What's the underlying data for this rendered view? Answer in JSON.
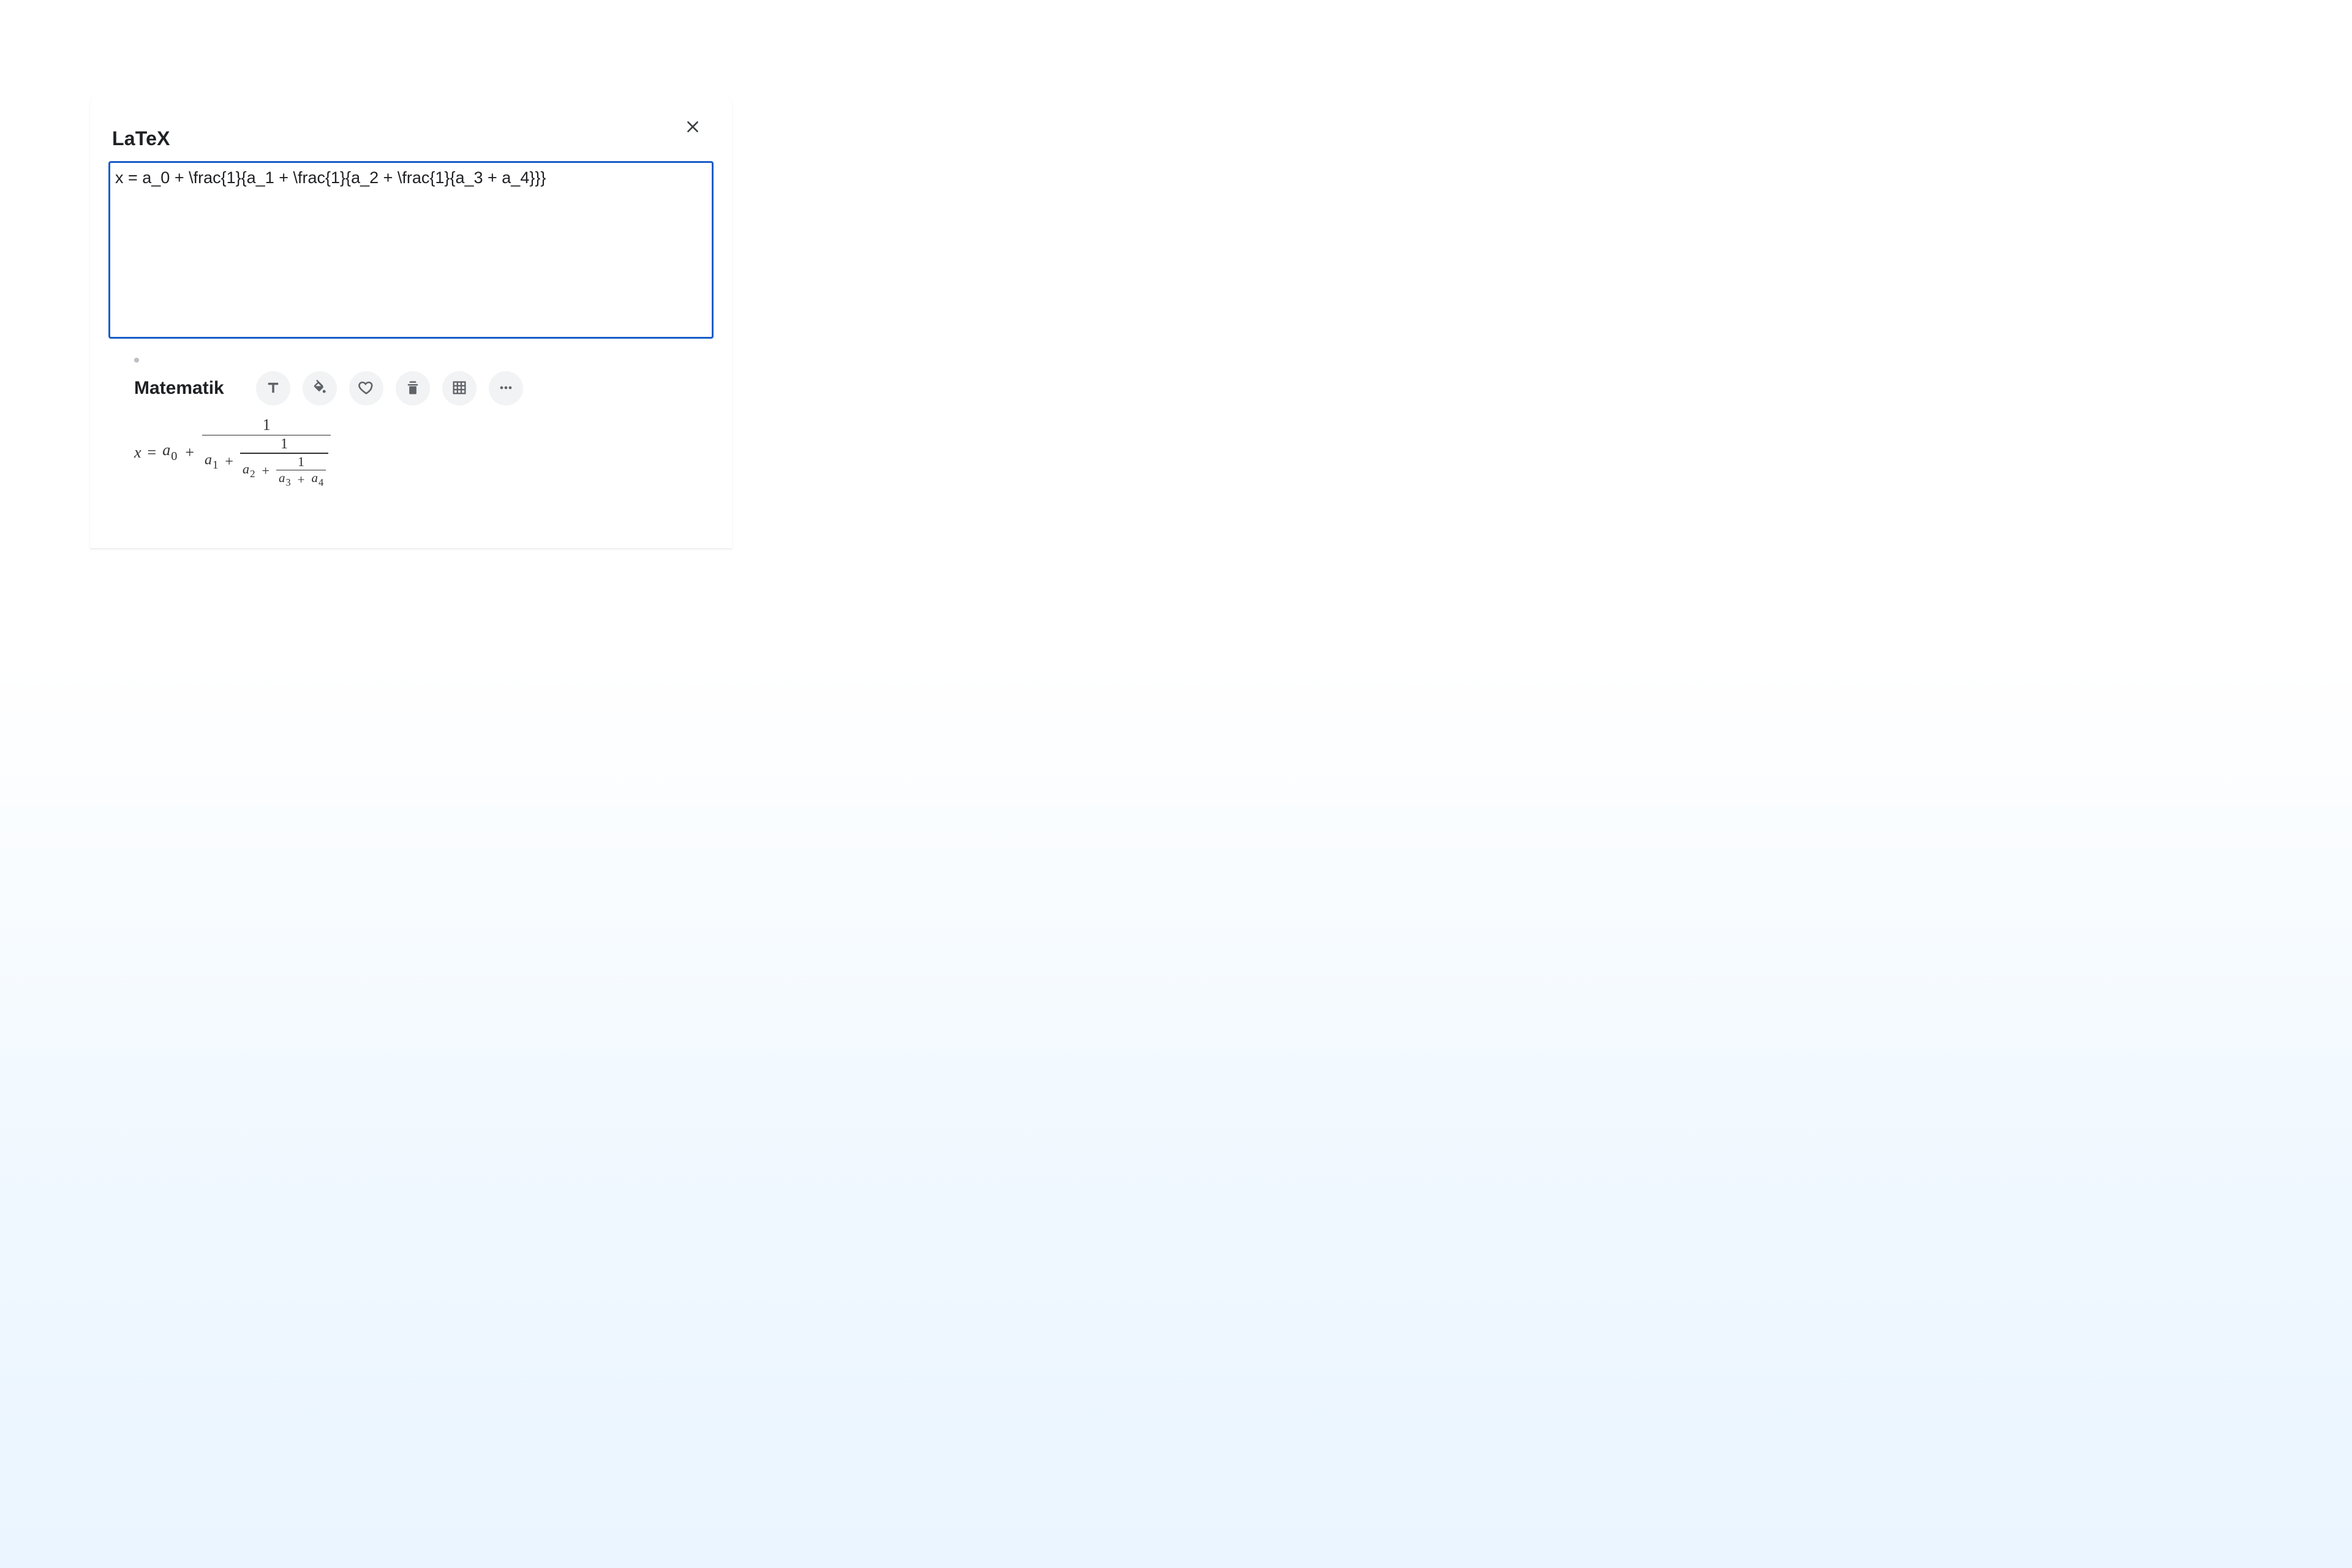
{
  "dialog": {
    "title": "LaTeX",
    "close_icon": "close-icon"
  },
  "editor": {
    "value": "x = a_0 + \\frac{1}{a_1 + \\frac{1}{a_2 + \\frac{1}{a_3 + a_4}}}",
    "placeholder": ""
  },
  "preview": {
    "label": "Matematik"
  },
  "toolbar": {
    "items": [
      {
        "name": "text-style-button",
        "icon": "type-icon"
      },
      {
        "name": "fill-button",
        "icon": "fill-icon"
      },
      {
        "name": "favorite-button",
        "icon": "heart-icon"
      },
      {
        "name": "delete-button",
        "icon": "trash-icon"
      },
      {
        "name": "grid-button",
        "icon": "grid-icon"
      },
      {
        "name": "more-button",
        "icon": "more-icon"
      }
    ]
  },
  "math": {
    "x": "x",
    "eq": "=",
    "a": "a",
    "plus": "+",
    "sub0": "0",
    "sub1": "1",
    "sub2": "2",
    "sub3": "3",
    "sub4": "4",
    "one": "1"
  },
  "colors": {
    "focus_border": "#1a5ec8",
    "toolbar_bg": "#f1f3f4",
    "toolbar_fg": "#5f6368"
  }
}
